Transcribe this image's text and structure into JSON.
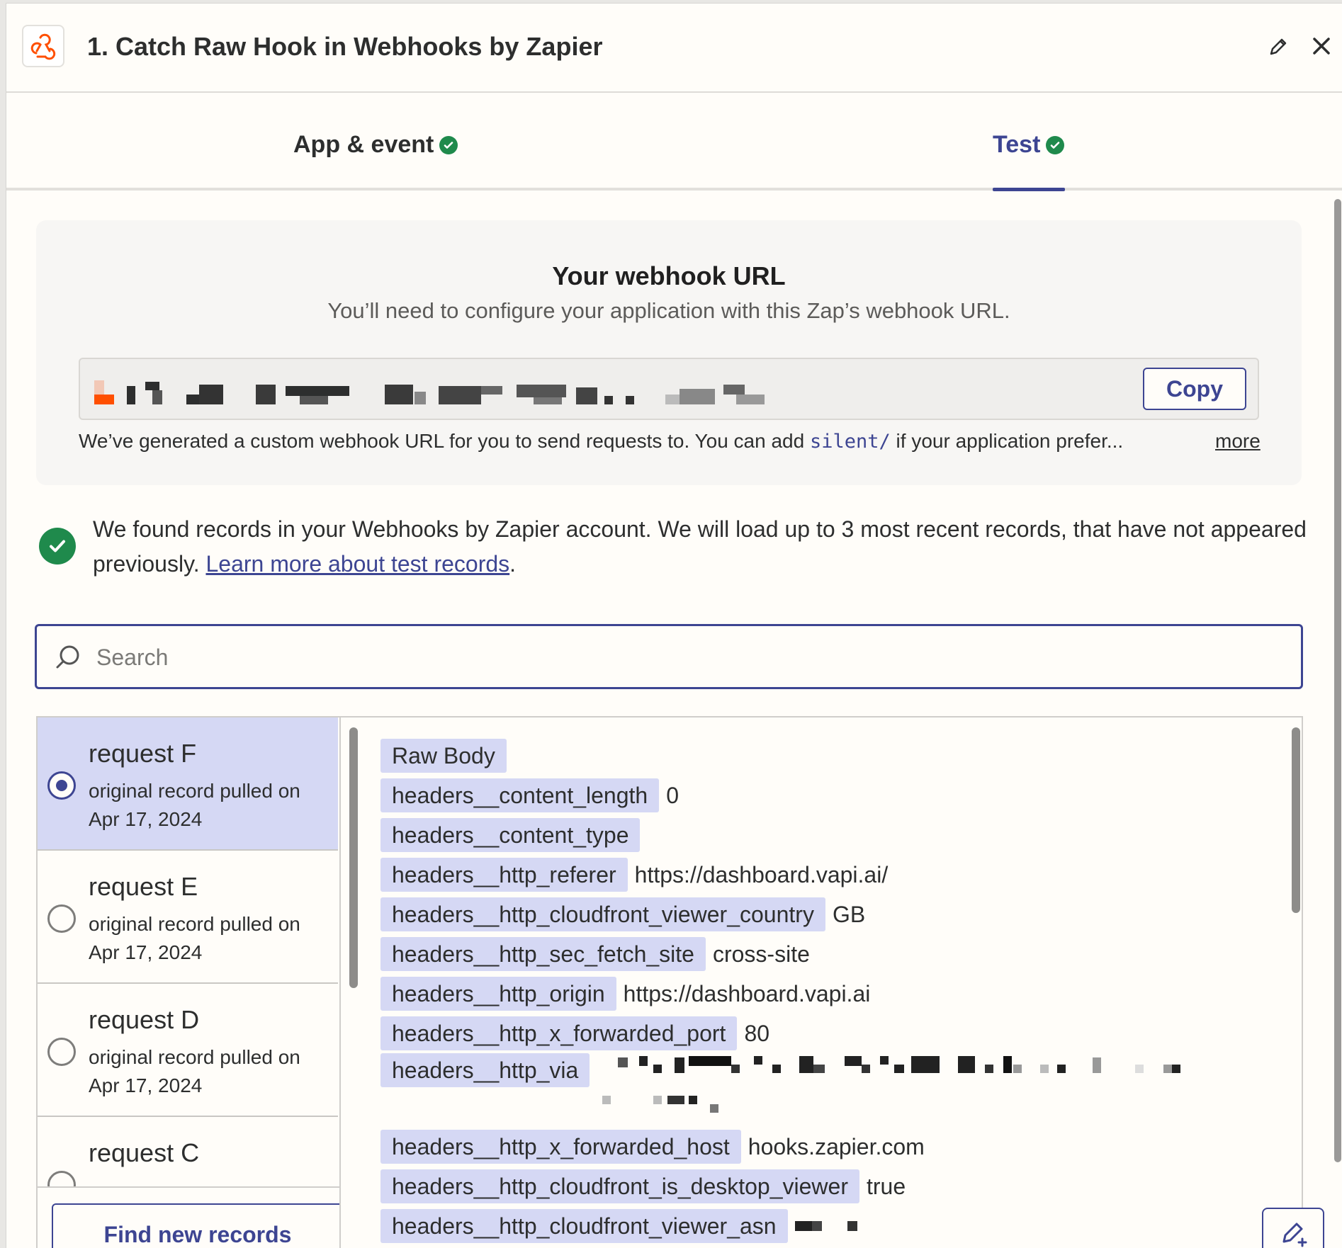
{
  "header": {
    "title": "1. Catch Raw Hook in Webhooks by Zapier",
    "app_icon": "webhooks-icon",
    "edit_icon": "pencil-icon",
    "close_icon": "close-icon"
  },
  "tabs": [
    {
      "label": "App & event",
      "status": "complete"
    },
    {
      "label": "Test",
      "status": "complete",
      "active": true
    }
  ],
  "webhook": {
    "title": "Your webhook URL",
    "subtitle": "You’ll need to configure your application with this Zap’s webhook URL.",
    "url_redacted": true,
    "copy_label": "Copy",
    "note_before": "We’ve generated a custom webhook URL for you to send requests to. You can add ",
    "note_code": "silent/",
    "note_after": " if your application prefer...",
    "more_label": "more"
  },
  "info": {
    "text": "We found records in your Webhooks by Zapier account. We will load up to 3 most recent records, that have not appeared previously. ",
    "link": "Learn more about test records",
    "suffix": "."
  },
  "search": {
    "placeholder": "Search",
    "value": ""
  },
  "records": [
    {
      "title": "request F",
      "subtitle": "original record pulled on Apr 17, 2024",
      "selected": true
    },
    {
      "title": "request E",
      "subtitle": "original record pulled on Apr 17, 2024",
      "selected": false
    },
    {
      "title": "request D",
      "subtitle": "original record pulled on Apr 17, 2024",
      "selected": false
    },
    {
      "title": "request C",
      "subtitle": "",
      "selected": false
    }
  ],
  "find_button": "Find new records",
  "fields": [
    {
      "key": "Raw Body",
      "value": ""
    },
    {
      "key": "headers__content_length",
      "value": "0"
    },
    {
      "key": "headers__content_type",
      "value": ""
    },
    {
      "key": "headers__http_referer",
      "value": "https://dashboard.vapi.ai/"
    },
    {
      "key": "headers__http_cloudfront_viewer_country",
      "value": "GB"
    },
    {
      "key": "headers__http_sec_fetch_site",
      "value": "cross-site"
    },
    {
      "key": "headers__http_origin",
      "value": "https://dashboard.vapi.ai"
    },
    {
      "key": "headers__http_x_forwarded_port",
      "value": "80"
    },
    {
      "key": "headers__http_via",
      "value": "",
      "redacted": true
    },
    {
      "key": "headers__http_x_forwarded_host",
      "value": "hooks.zapier.com"
    },
    {
      "key": "headers__http_cloudfront_is_desktop_viewer",
      "value": "true"
    },
    {
      "key": "headers__http_cloudfront_viewer_asn",
      "value": "",
      "redacted": true
    }
  ],
  "colors": {
    "accent": "#3d4592",
    "success": "#1f8a4c",
    "selected_bg": "#d5d8f4",
    "brand": "#ff4f00"
  }
}
